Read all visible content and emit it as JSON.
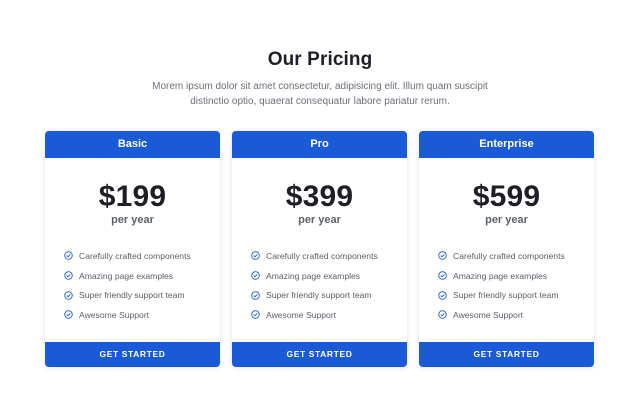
{
  "header": {
    "title": "Our Pricing",
    "subtitle": "Morem ipsum dolor sit amet consectetur, adipisicing elit. Illum quam suscipit distinctio optio, quaerat consequatur labore pariatur rerum."
  },
  "plans": [
    {
      "name": "Basic",
      "price": "$199",
      "period": "per year",
      "features": [
        "Carefully crafted components",
        "Amazing page examples",
        "Super friendly support team",
        "Awesome Support"
      ],
      "cta": "GET STARTED"
    },
    {
      "name": "Pro",
      "price": "$399",
      "period": "per year",
      "features": [
        "Carefully crafted components",
        "Amazing page examples",
        "Super friendly support team",
        "Awesome Support"
      ],
      "cta": "GET STARTED"
    },
    {
      "name": "Enterprise",
      "price": "$599",
      "period": "per year",
      "features": [
        "Carefully crafted components",
        "Amazing page examples",
        "Super friendly support team",
        "Awesome Support"
      ],
      "cta": "GET STARTED"
    }
  ],
  "icons": {
    "feature": "check-circle-icon"
  },
  "colors": {
    "accent": "#1a5ad7",
    "check": "#1a5ad7",
    "heading": "#1d1f24",
    "muted": "#6b6f76"
  }
}
